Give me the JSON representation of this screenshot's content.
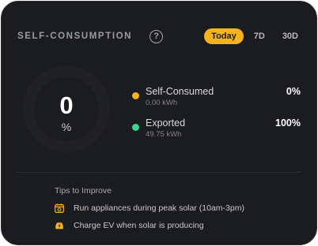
{
  "header": {
    "title": "SELF-CONSUMPTION",
    "help_icon": "?",
    "tabs": [
      {
        "label": "Today",
        "active": true
      },
      {
        "label": "7D",
        "active": false
      },
      {
        "label": "30D",
        "active": false
      }
    ]
  },
  "ring": {
    "value": "0",
    "unit": "%",
    "fill_fraction": 0
  },
  "legend": [
    {
      "label": "Self-Consumed",
      "sub": "0.00 kWh",
      "pct": "0%",
      "color": "#f5b31c"
    },
    {
      "label": "Exported",
      "sub": "49.75 kWh",
      "pct": "100%",
      "color": "#3ad58e"
    }
  ],
  "tips": {
    "title": "Tips to Improve",
    "items": [
      {
        "icon": "calendar-clock-icon",
        "text": "Run appliances during peak solar (10am-3pm)"
      },
      {
        "icon": "ev-charging-icon",
        "text": "Charge EV when solar is producing"
      }
    ]
  },
  "colors": {
    "accent": "#f5b31c",
    "export": "#3ad58e",
    "background": "#1b1c20"
  }
}
